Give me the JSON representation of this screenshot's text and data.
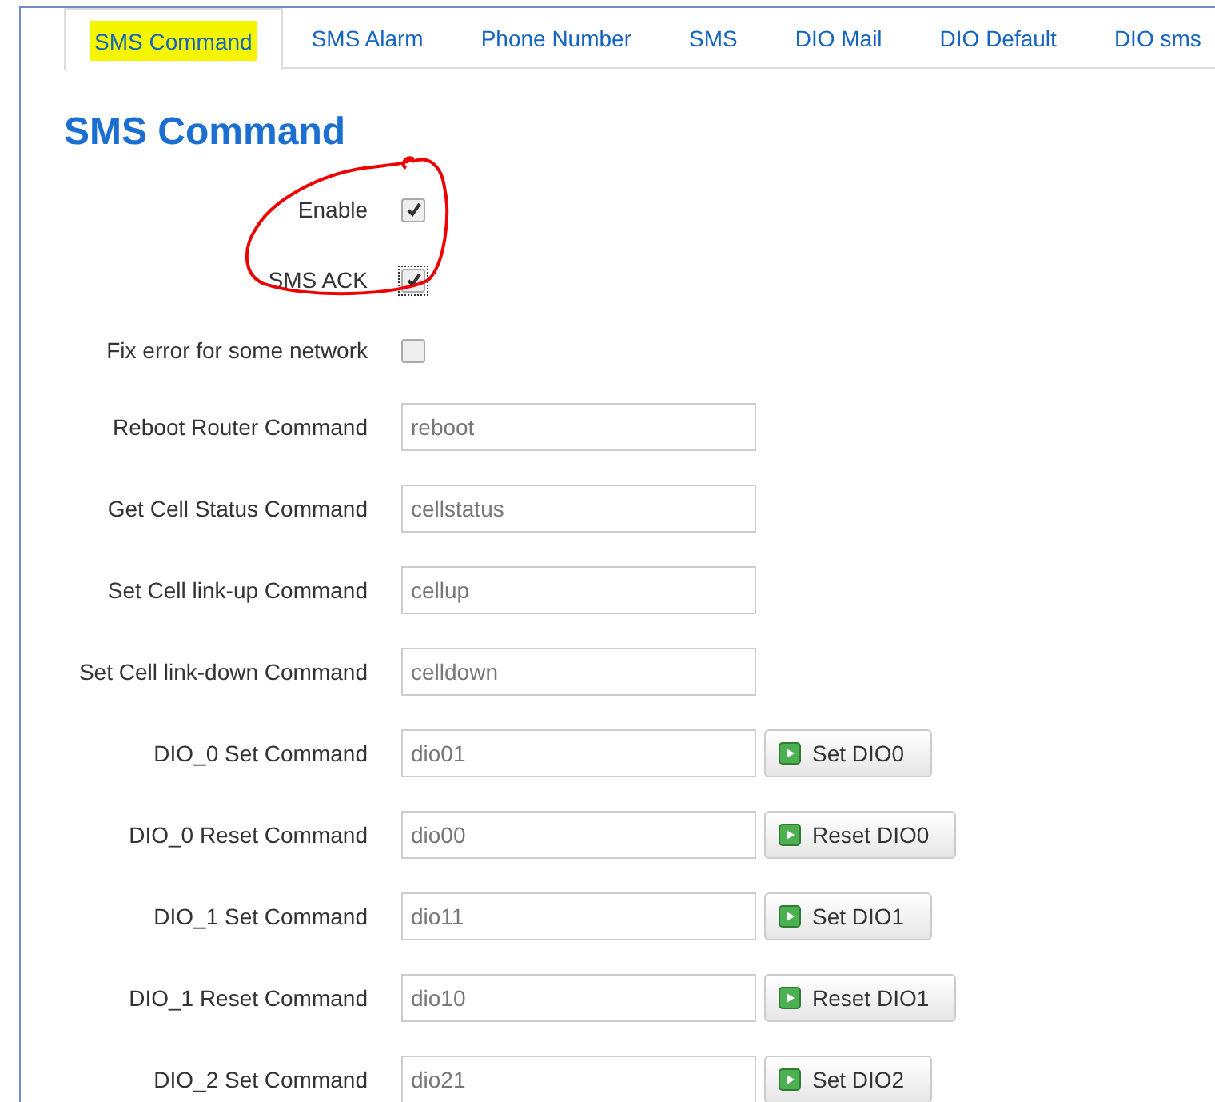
{
  "tabs": [
    {
      "label": "SMS Command",
      "selected": true,
      "highlighted": true
    },
    {
      "label": "SMS Alarm",
      "selected": false,
      "highlighted": false
    },
    {
      "label": "Phone Number",
      "selected": false,
      "highlighted": false
    },
    {
      "label": "SMS",
      "selected": false,
      "highlighted": false
    },
    {
      "label": "DIO Mail",
      "selected": false,
      "highlighted": false
    },
    {
      "label": "DIO Default",
      "selected": false,
      "highlighted": false
    },
    {
      "label": "DIO sms",
      "selected": false,
      "highlighted": false
    }
  ],
  "title": "SMS Command",
  "annotation": {
    "kind": "circle"
  },
  "rows": [
    {
      "kind": "checkbox",
      "label": "Enable",
      "checked": true,
      "focused": false
    },
    {
      "kind": "checkbox",
      "label": "SMS ACK",
      "checked": true,
      "focused": true
    },
    {
      "kind": "checkbox",
      "label": "Fix error for some network",
      "checked": false,
      "focused": false
    },
    {
      "kind": "text",
      "label": "Reboot Router Command",
      "value": "reboot"
    },
    {
      "kind": "text",
      "label": "Get Cell Status Command",
      "value": "cellstatus"
    },
    {
      "kind": "text",
      "label": "Set Cell link-up Command",
      "value": "cellup"
    },
    {
      "kind": "text",
      "label": "Set Cell link-down Command",
      "value": "celldown"
    },
    {
      "kind": "text",
      "label": "DIO_0 Set Command",
      "value": "dio01",
      "button": "Set DIO0"
    },
    {
      "kind": "text",
      "label": "DIO_0 Reset Command",
      "value": "dio00",
      "button": "Reset DIO0"
    },
    {
      "kind": "text",
      "label": "DIO_1 Set Command",
      "value": "dio11",
      "button": "Set DIO1"
    },
    {
      "kind": "text",
      "label": "DIO_1 Reset Command",
      "value": "dio10",
      "button": "Reset DIO1"
    },
    {
      "kind": "text",
      "label": "DIO_2 Set Command",
      "value": "dio21",
      "button": "Set DIO2"
    }
  ]
}
